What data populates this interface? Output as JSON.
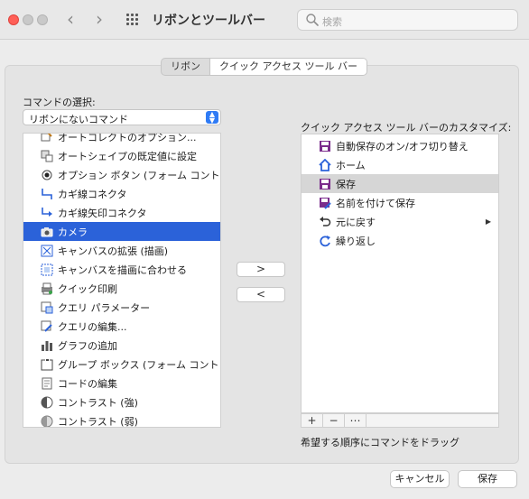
{
  "window": {
    "title": "リボンとツールバー",
    "search_placeholder": "検索"
  },
  "tabs": [
    {
      "label": "リボン",
      "active": false
    },
    {
      "label": "クイック アクセス ツール バー",
      "active": true
    }
  ],
  "left": {
    "label": "コマンドの選択:",
    "dropdown_value": "リボンにないコマンド",
    "items": [
      {
        "label": "オートコレクトのオプション...",
        "icon": "autocorrect-icon"
      },
      {
        "label": "オートシェイプの既定値に設定",
        "icon": "autoshape-default-icon"
      },
      {
        "label": "オプション ボタン (フォーム コントロ...",
        "icon": "option-button-icon"
      },
      {
        "label": "カギ線コネクタ",
        "icon": "elbow-connector-icon"
      },
      {
        "label": "カギ線矢印コネクタ",
        "icon": "elbow-arrow-connector-icon"
      },
      {
        "label": "カメラ",
        "icon": "camera-icon",
        "selected": true
      },
      {
        "label": "キャンバスの拡張 (描画)",
        "icon": "expand-canvas-icon"
      },
      {
        "label": "キャンバスを描画に合わせる",
        "icon": "fit-canvas-icon"
      },
      {
        "label": "クイック印刷",
        "icon": "quick-print-icon"
      },
      {
        "label": "クエリ パラメーター",
        "icon": "query-parameters-icon"
      },
      {
        "label": "クエリの編集...",
        "icon": "edit-query-icon"
      },
      {
        "label": "グラフの追加",
        "icon": "add-chart-icon"
      },
      {
        "label": "グループ ボックス (フォーム コントロ...",
        "icon": "group-box-icon"
      },
      {
        "label": "コードの編集",
        "icon": "edit-code-icon"
      },
      {
        "label": "コントラスト (強)",
        "icon": "contrast-more-icon"
      },
      {
        "label": "コントラスト (弱)",
        "icon": "contrast-less-icon"
      }
    ]
  },
  "move": {
    "add_label": ">",
    "remove_label": "<"
  },
  "right": {
    "label": "クイック アクセス ツール バーのカスタマイズ:",
    "items": [
      {
        "label": "自動保存のオン/オフ切り替え",
        "icon": "autosave-toggle-icon"
      },
      {
        "label": "ホーム",
        "icon": "home-icon"
      },
      {
        "label": "保存",
        "icon": "save-icon",
        "selected": true
      },
      {
        "label": "名前を付けて保存",
        "icon": "save-as-icon"
      },
      {
        "label": "元に戻す",
        "icon": "undo-icon",
        "has_submenu": true
      },
      {
        "label": "繰り返し",
        "icon": "redo-icon"
      }
    ],
    "toolbar": {
      "add_label": "+",
      "remove_label": "−",
      "more_label": "⋯"
    },
    "hint": "希望する順序にコマンドをドラッグ"
  },
  "footer": {
    "cancel_label": "キャンセル",
    "save_label": "保存"
  },
  "colors": {
    "selection_blue": "#2b62d9",
    "selection_gray": "#d6d6d6",
    "close_red": "#ff5f57",
    "save_icon_purple": "#7b2c8c",
    "home_icon_blue": "#2b62d9"
  }
}
